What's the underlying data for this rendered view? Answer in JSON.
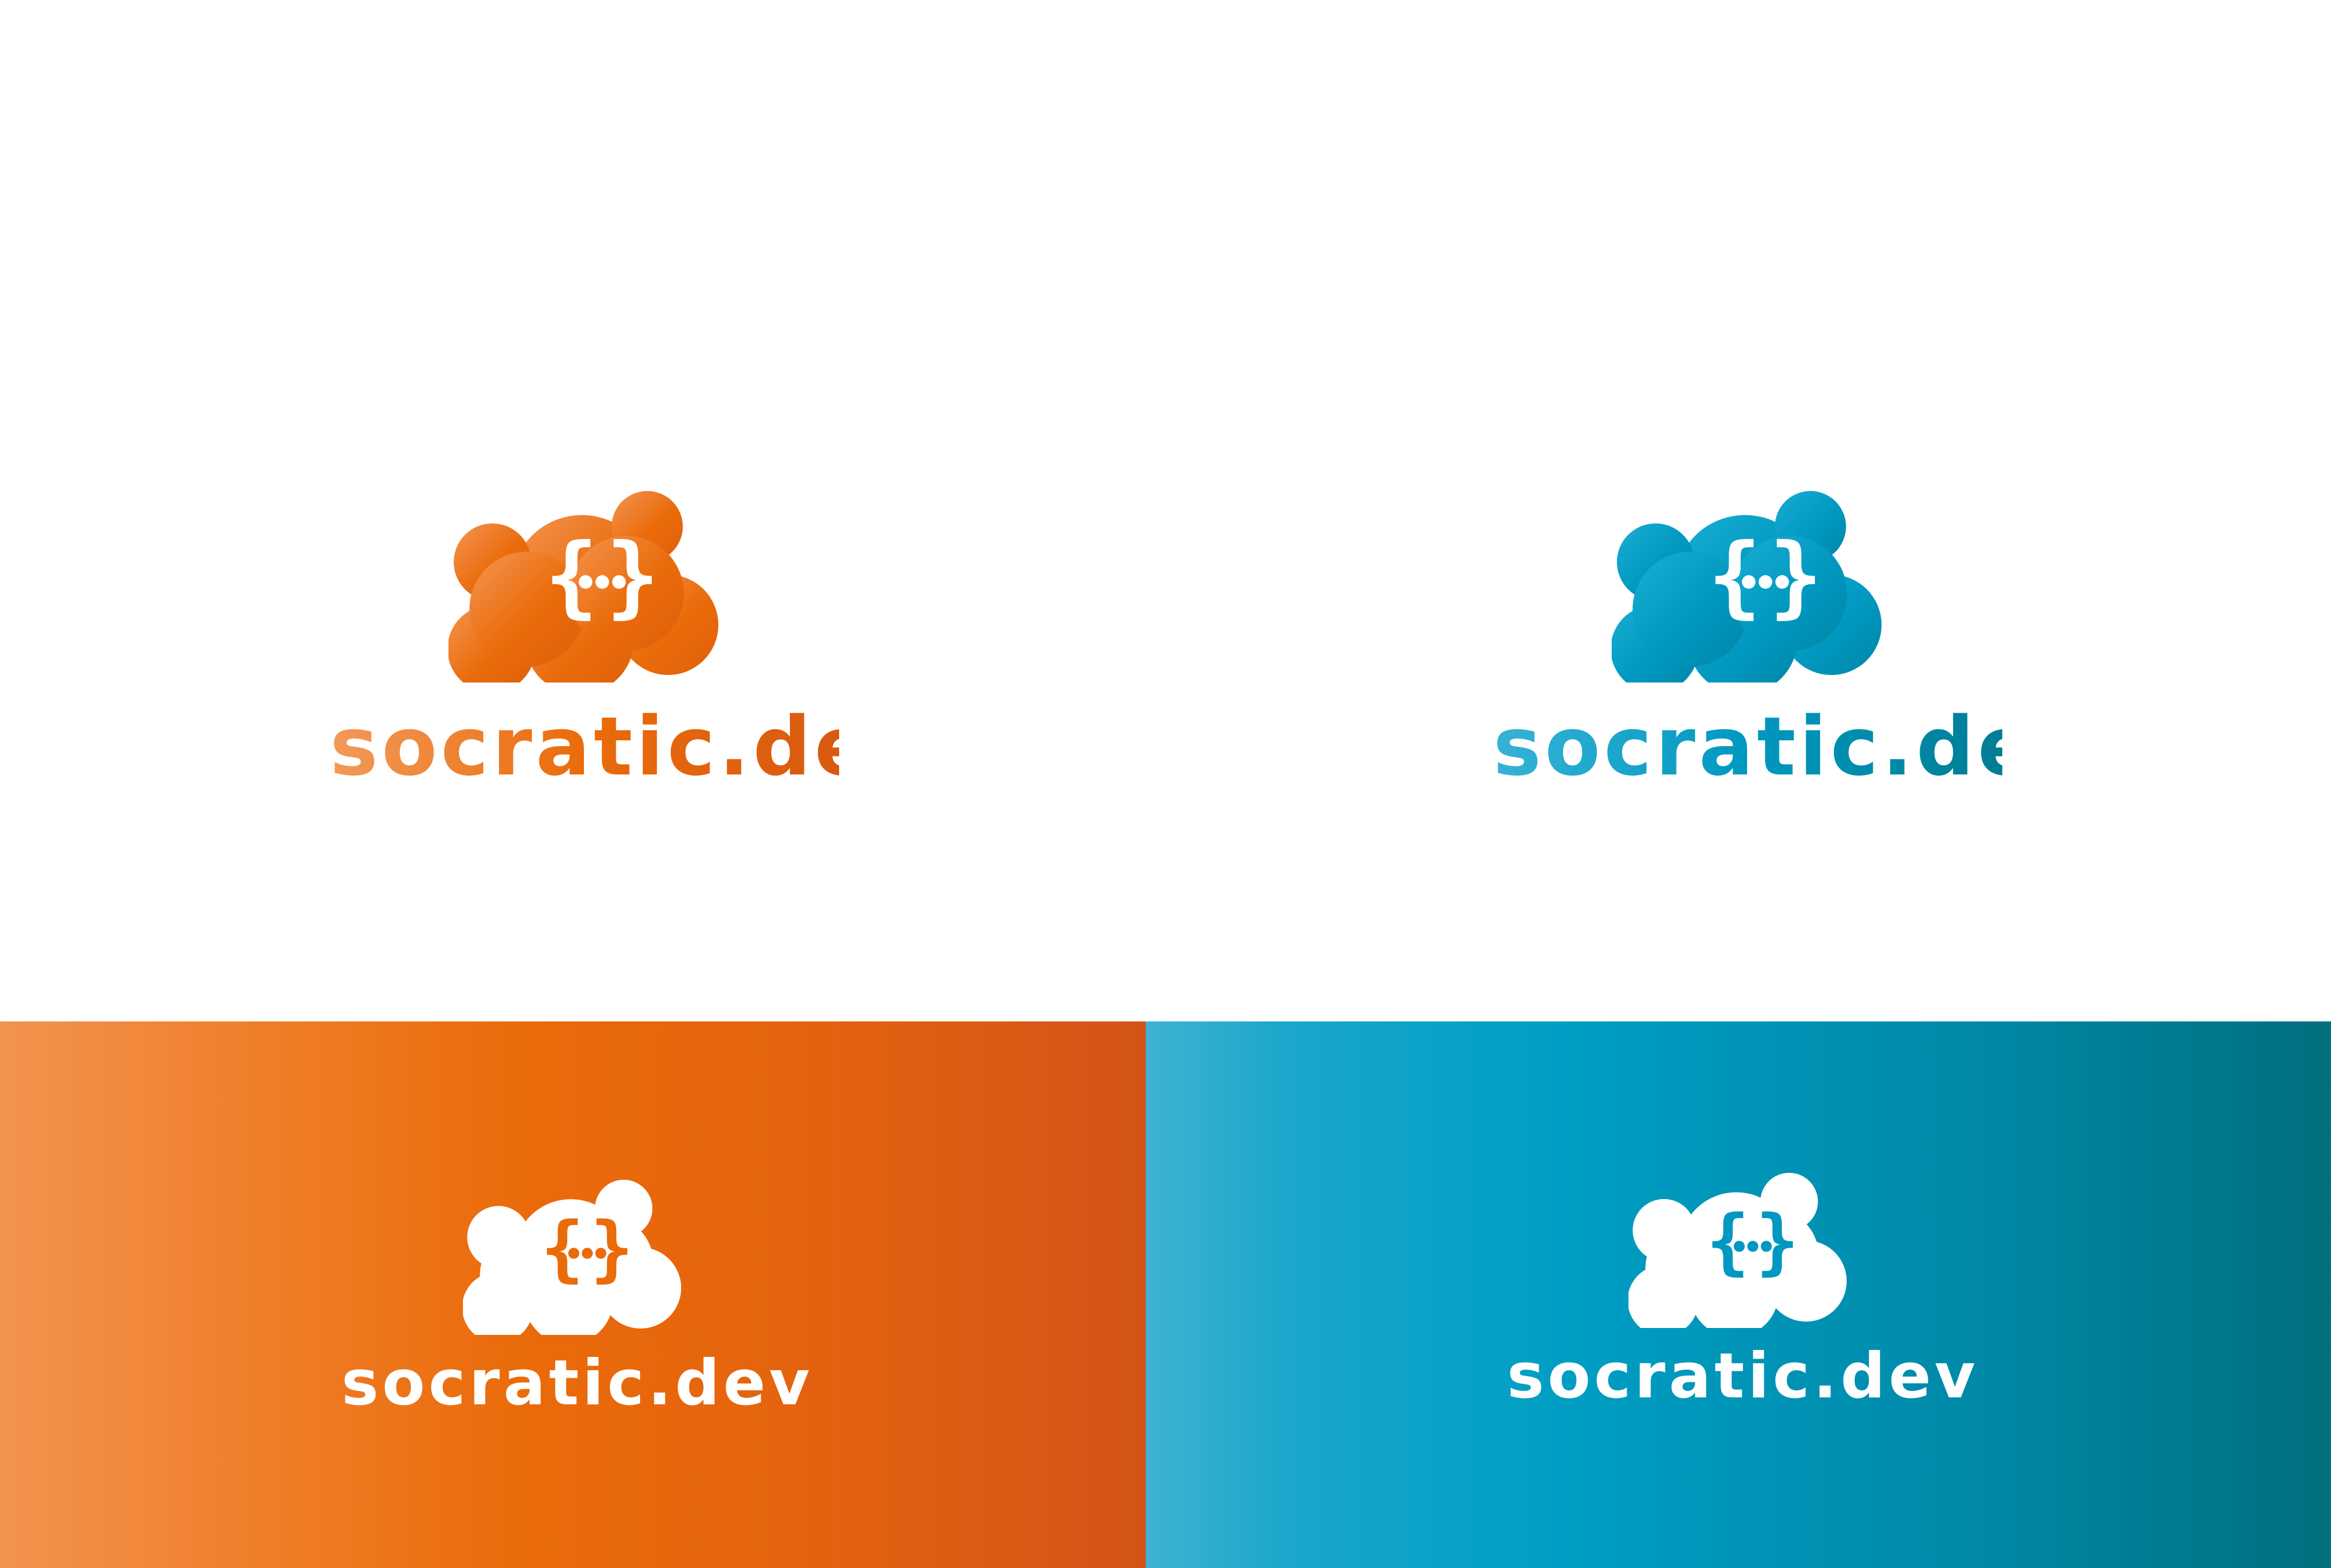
{
  "brand": {
    "name": "socratic.dev",
    "colors": {
      "orange_light": "#f3934f",
      "orange": "#ea6b0a",
      "orange_dark": "#d45418",
      "blue_light": "#3fb2d3",
      "blue": "#009ec4",
      "blue_dark": "#006f7d",
      "white": "#ffffff"
    }
  },
  "variants": [
    {
      "name": "orange-on-white",
      "wordmark": "socratic.dev",
      "icon": "cloud-braces-ellipsis-icon"
    },
    {
      "name": "blue-on-white",
      "wordmark": "socratic.dev",
      "icon": "cloud-braces-ellipsis-icon"
    },
    {
      "name": "white-on-orange",
      "wordmark": "socratic.dev",
      "icon": "cloud-braces-ellipsis-icon"
    },
    {
      "name": "white-on-blue",
      "wordmark": "socratic.dev",
      "icon": "cloud-braces-ellipsis-icon"
    }
  ]
}
